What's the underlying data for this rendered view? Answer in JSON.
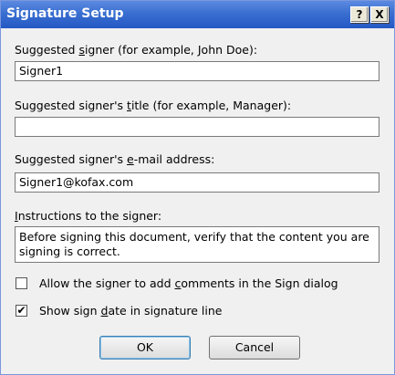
{
  "window": {
    "title": "Signature Setup",
    "help_glyph": "?",
    "close_glyph": "X"
  },
  "fields": {
    "signer_label": {
      "pre": "Suggested ",
      "accel": "s",
      "post": "igner (for example, John Doe):"
    },
    "signer_value": "Signer1",
    "title_label": {
      "pre": "Suggested signer's ",
      "accel": "t",
      "post": "itle (for example, Manager):"
    },
    "title_value": "",
    "email_label": {
      "pre": "Suggested signer's ",
      "accel": "e",
      "post": "-mail address:"
    },
    "email_value": "Signer1@kofax.com",
    "instructions_label": {
      "pre": "",
      "accel": "I",
      "post": "nstructions to the signer:"
    },
    "instructions_value": "Before signing this document, verify that the content you are signing is correct."
  },
  "options": {
    "allow_comments": {
      "pre": "Allow the signer to add ",
      "accel": "c",
      "post": "omments in the Sign dialog",
      "checked": false
    },
    "show_date": {
      "pre": "Show sign ",
      "accel": "d",
      "post": "ate in signature line",
      "checked": true
    },
    "check_glyph": "✔"
  },
  "buttons": {
    "ok": "OK",
    "cancel": "Cancel"
  }
}
